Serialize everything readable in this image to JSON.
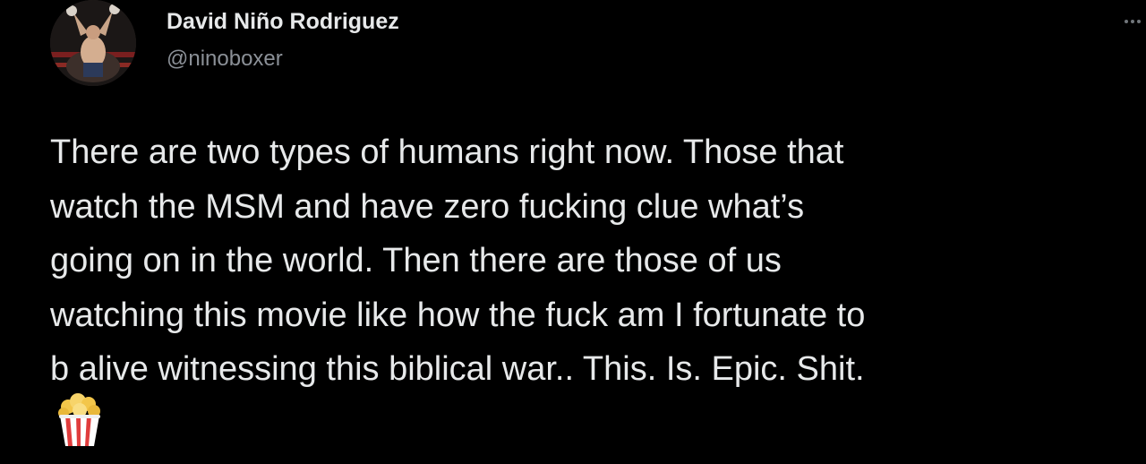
{
  "tweet": {
    "author": {
      "display_name": "David Niño Rodriguez",
      "handle": "@ninoboxer",
      "avatar_icon": "boxer-avatar"
    },
    "text_lines": [
      "There are two types of humans right now. Those that",
      "watch the MSM and have zero fucking clue what’s",
      "going on in the world. Then there are those of us",
      "watching this movie like how the fuck am I fortunate to",
      "b alive witnessing this biblical war.. This. Is. Epic. Shit."
    ],
    "emoji": "popcorn-icon",
    "more_icon": "more-options-icon"
  },
  "colors": {
    "background": "#000000",
    "primary_text": "#e7e9ea",
    "secondary_text": "#8b9097",
    "popcorn_red": "#e03c3c",
    "popcorn_kernel": "#f3c64a"
  }
}
